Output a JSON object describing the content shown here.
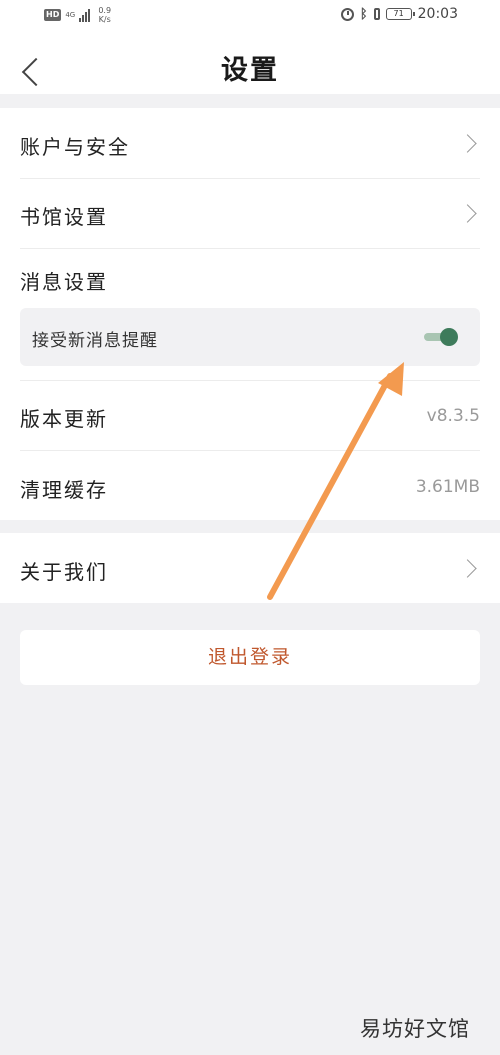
{
  "status_bar": {
    "hd_badge": "HD",
    "network": "4G",
    "speed_value": "0.9",
    "speed_unit": "K/s",
    "battery": "71",
    "time": "20:03"
  },
  "header": {
    "title": "设置"
  },
  "settings": {
    "account_security": "账户与安全",
    "library_settings": "书馆设置",
    "message_settings": "消息设置",
    "receive_notifications": "接受新消息提醒",
    "receive_notifications_enabled": true,
    "version_update": "版本更新",
    "version_value": "v8.3.5",
    "clear_cache": "清理缓存",
    "cache_value": "3.61MB",
    "about_us": "关于我们"
  },
  "logout_label": "退出登录",
  "watermark": "易坊好文馆",
  "colors": {
    "accent_toggle": "#3e7b5b",
    "logout_text": "#c0582e",
    "annotation_arrow": "#f39a4f"
  }
}
